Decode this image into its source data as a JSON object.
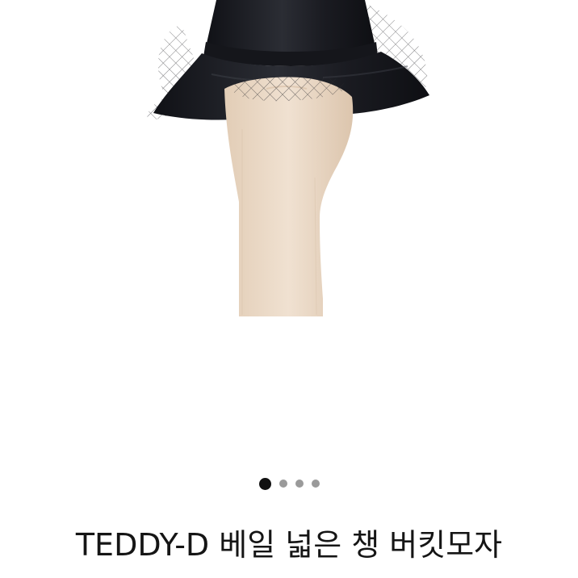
{
  "product": {
    "title": "TEDDY-D 베일 넓은 챙 버킷모자",
    "image_alt": "black bucket hat with veil on wooden mannequin head"
  },
  "pager": {
    "total": 4,
    "active_index": 0
  },
  "colors": {
    "active_dot": "#111111",
    "inactive_dot": "#9a9a9a",
    "hat": "#1b1c21",
    "mannequin": "#e9d8c5"
  }
}
